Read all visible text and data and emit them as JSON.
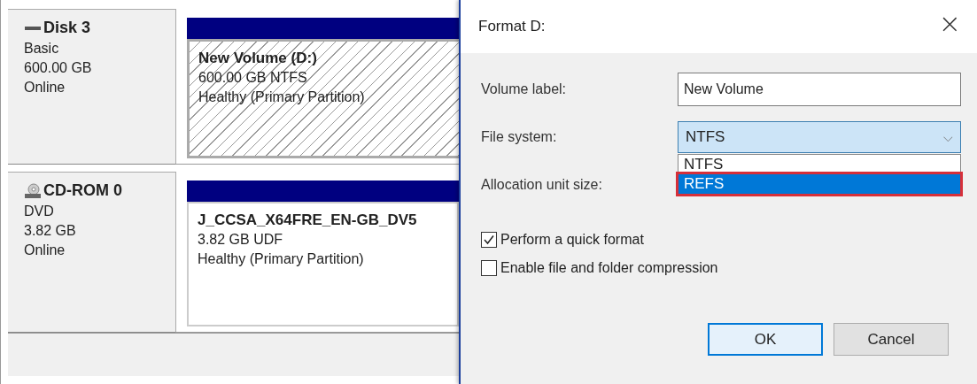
{
  "disks": [
    {
      "kind": "disk",
      "name": "Disk 3",
      "type": "Basic",
      "size": "600.00 GB",
      "status": "Online",
      "volume": {
        "name": "New Volume  (D:)",
        "detail": "600.00 GB NTFS",
        "health": "Healthy (Primary Partition)",
        "selected": true
      }
    },
    {
      "kind": "cdrom",
      "name": "CD-ROM 0",
      "type": "DVD",
      "size": "3.82 GB",
      "status": "Online",
      "volume": {
        "name": "J_CCSA_X64FRE_EN-GB_DV5",
        "detail": "3.82 GB UDF",
        "health": "Healthy (Primary Partition)",
        "selected": false
      }
    }
  ],
  "dialog": {
    "title": "Format D:",
    "close": "×",
    "volume_label": {
      "label": "Volume label:",
      "value": "New Volume"
    },
    "file_system": {
      "label": "File system:",
      "value": "NTFS",
      "caret": "⌵",
      "options": [
        {
          "label": "NTFS",
          "highlighted": false
        },
        {
          "label": "REFS",
          "highlighted": true
        }
      ]
    },
    "allocation": {
      "label": "Allocation unit size:"
    },
    "checkboxes": [
      {
        "label": "Perform a quick format",
        "checked": true
      },
      {
        "label": "Enable file and folder compression",
        "checked": false
      }
    ],
    "buttons": [
      {
        "label": "OK",
        "default": true
      },
      {
        "label": "Cancel",
        "default": false
      }
    ]
  }
}
